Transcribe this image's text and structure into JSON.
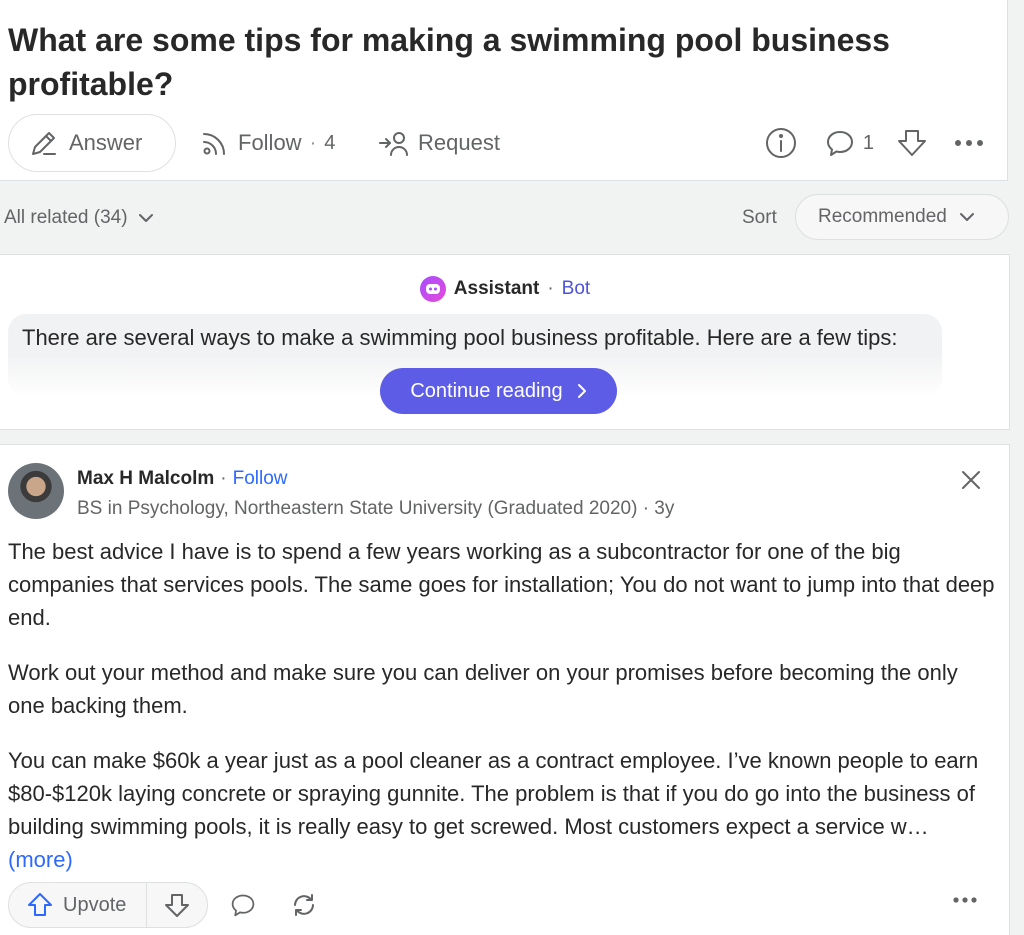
{
  "question": {
    "title": "What are some tips for making a swimming pool business profitable?",
    "answer_label": "Answer",
    "follow_label": "Follow",
    "follow_count": "4",
    "request_label": "Request",
    "comment_count": "1",
    "icons": [
      "pencil-icon",
      "follow-icon",
      "request-icon",
      "info-icon",
      "comment-icon",
      "downvote-icon",
      "more-icon"
    ]
  },
  "sort_bar": {
    "all_related": "All related (34)",
    "sort_label": "Sort",
    "sort_value": "Recommended"
  },
  "assistant": {
    "name": "Assistant",
    "bot_label": "Bot",
    "text": "There are several ways to make a swimming pool business profitable. Here are a few tips:",
    "continue_label": "Continue reading",
    "accent_color": "#5c5ce6"
  },
  "answer": {
    "author": "Max H Malcolm",
    "follow_label": "Follow",
    "credential": "BS in Psychology, Northeastern State University (Graduated 2020) · 3y",
    "paragraphs": [
      "The best advice I have is to spend a few years working as a subcontractor for one of the big companies that services pools. The same goes for installation; You do not want to jump into that deep end.",
      "Work out your method and make sure you can deliver on your promises before becoming the only one backing them.",
      "You can make $60k a year just as a pool cleaner as a contract employee. I’ve known people to earn $80-$120k laying concrete or spraying gunnite. The problem is that if you do go into the business of building swimming pools, it is really easy to get screwed. Most customers expect a service w…"
    ],
    "more_label": "(more)",
    "upvote_label": "Upvote",
    "link_color": "#2e69ff"
  }
}
